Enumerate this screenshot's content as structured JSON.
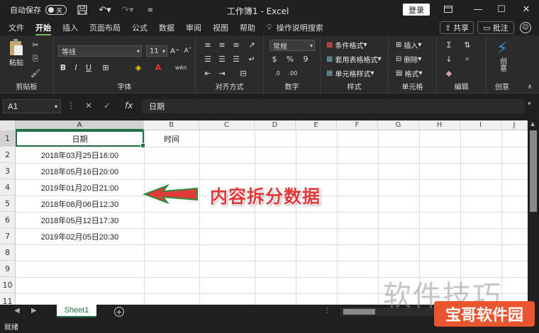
{
  "title_bar": {
    "autosave_label": "自动保存",
    "autosave_state": "关",
    "window_title": "工作簿1 - Excel",
    "login_label": "登录"
  },
  "menu": {
    "tabs": [
      "文件",
      "开始",
      "插入",
      "页面布局",
      "公式",
      "数据",
      "审阅",
      "视图",
      "帮助"
    ],
    "active_tab": "开始",
    "search_label": "操作说明搜索",
    "share_label": "共享",
    "comment_label": "批注"
  },
  "ribbon": {
    "clipboard": {
      "paste_label": "粘贴",
      "group_label": "剪贴板"
    },
    "font": {
      "font_name": "等线",
      "font_size": "11",
      "group_label": "字体"
    },
    "alignment": {
      "group_label": "对齐方式"
    },
    "number": {
      "format": "常规",
      "group_label": "数字"
    },
    "styles": {
      "conditional": "条件格式",
      "table": "套用表格格式",
      "cell": "单元格样式",
      "group_label": "样式"
    },
    "cells": {
      "insert": "插入",
      "delete": "删除",
      "format": "格式",
      "group_label": "单元格"
    },
    "editing": {
      "group_label": "编辑"
    },
    "ideas": {
      "create_label": "创意",
      "group_label": "创意"
    }
  },
  "formula_bar": {
    "name_box": "A1",
    "content": "日期"
  },
  "grid": {
    "columns": [
      "A",
      "B",
      "C",
      "D",
      "E",
      "F",
      "G",
      "H",
      "I",
      "J"
    ],
    "rows": [
      "1",
      "2",
      "3",
      "4",
      "5",
      "6",
      "7",
      "8",
      "9",
      "10",
      "11"
    ],
    "cells": {
      "A1": "日期",
      "B1": "时间",
      "A2": "2018年03月25日16:00",
      "A3": "2018年05月16日20:00",
      "A4": "2019年01月20日21:00",
      "A5": "2018年08月06日12:30",
      "A6": "2018年05月12日17:30",
      "A7": "2019年02月05日20:30"
    }
  },
  "annotation": "内容拆分数据",
  "sheets": {
    "active": "Sheet1"
  },
  "status": "就绪",
  "watermarks": {
    "text1": "软件技巧",
    "text2": "宝哥软件园"
  },
  "colors": {
    "accent": "#217346",
    "annotation": "#e13a3a"
  }
}
